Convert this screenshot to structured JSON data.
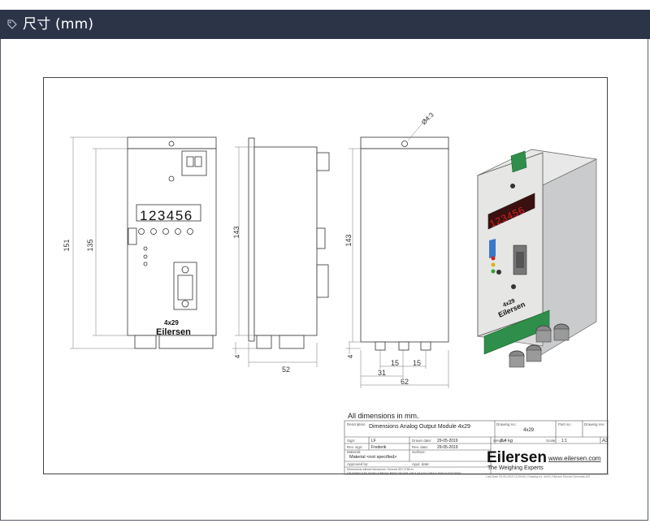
{
  "header": {
    "title": "尺寸 (mm)",
    "icon": "tag-icon"
  },
  "drawing": {
    "front": {
      "display": "123456",
      "brand": "Eilersen",
      "model": "4x29"
    },
    "dims": {
      "d151": "151",
      "d135": "135",
      "d143a": "143",
      "d52": "52",
      "d143b": "143",
      "d4a": "4",
      "d4b": "4",
      "d15a": "15",
      "d15b": "15",
      "d31": "31",
      "d62": "62",
      "hole": "Ø4.3"
    },
    "iso": {
      "display": "123456",
      "brand": "Eilersen",
      "model": "4x29"
    },
    "note": "All dimensions in mm."
  },
  "title_block": {
    "description_label": "Description",
    "description": "Dimensions Analog Output Module 4x29",
    "drawing_no_label": "Drawing no.:",
    "drawing_no": "4x29",
    "part_no_label": "Part no.:",
    "part_no": "",
    "drawing_rev_label": "Drawing rev.:",
    "drawing_rev": "",
    "sign_label": "Sign:",
    "sign": "LF",
    "drawn_date_label": "Drawn date:",
    "drawn_date": "29-05-2019",
    "weight_label": "Weight:",
    "weight": "0.4 kg",
    "scale_label": "Scale:",
    "scale": "1:1",
    "size": "A3",
    "rev_sign_label": "Rev. sign:",
    "rev_sign": "Frederik",
    "rev_date_label": "Rev. date:",
    "rev_date": "29-05-2019",
    "material_label": "Material:",
    "material": "Material <not specified>",
    "surface_label": "Surface:",
    "approved_label": "Approved by:",
    "appr_date_label": "Appr. date:",
    "tolerance_note": "Dimensions without tolerances: General ISO 2768-m",
    "property_note": "This drawing is the property of Eilersen Electric Denmark, and is not to be copied or shown to third parties.",
    "company_logo": "Eilersen",
    "tagline": "The Weighing Experts",
    "website": "www.eilersen.com",
    "footer": "Last Date 29-05-2019 13:09:06  |  Drawing no. 4x29  |  Eilersen Electric Denmark A/S"
  }
}
